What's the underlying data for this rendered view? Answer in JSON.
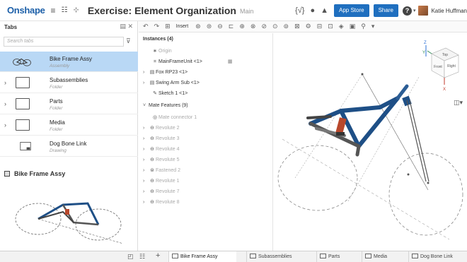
{
  "app": {
    "logo": "Onshape",
    "title": "Exercise: Element Organization",
    "branch": "Main"
  },
  "header": {
    "app_store": "App Store",
    "share": "Share",
    "help": "?",
    "user": "Katie Huffman"
  },
  "tabs_panel": {
    "title": "Tabs",
    "search_placeholder": "Search tabs",
    "items": [
      {
        "name": "Bike Frame Assy",
        "type": "Assembly",
        "selected": true
      },
      {
        "name": "Subassemblies",
        "type": "Folder"
      },
      {
        "name": "Parts",
        "type": "Folder"
      },
      {
        "name": "Media",
        "type": "Folder"
      },
      {
        "name": "Dog Bone Link",
        "type": "Drawing"
      }
    ],
    "preview_title": "Bike Frame Assy"
  },
  "toolbar": {
    "insert": "Insert"
  },
  "tree": {
    "instances_header": "Instances (4)",
    "origin": "Origin",
    "instances": [
      "MainFrameUnit <1>",
      "Fox RP23 <1>",
      "Swing Arm Sub <1>",
      "Sketch 1 <1>"
    ],
    "mate_header": "Mate Features (9)",
    "mates": [
      "Mate connector 1",
      "Revolute 2",
      "Revolute 3",
      "Revolute 4",
      "Revolute 5",
      "Fastened 2",
      "Revolute 1",
      "Revolute 7",
      "Revolute 8"
    ]
  },
  "view_cube": {
    "top": "Top",
    "front": "Front",
    "right": "Right",
    "x": "X",
    "y": "Y",
    "z": "Z"
  },
  "bottom_tabs": [
    "Bike Frame Assy",
    "Subassemblies",
    "Parts",
    "Media",
    "Dog Bone Link"
  ],
  "colors": {
    "brand": "#1c5fa8",
    "button": "#1f6fbf",
    "selected": "#b9d8f5",
    "frame": "#1e4f86",
    "shock": "#b8482c"
  }
}
